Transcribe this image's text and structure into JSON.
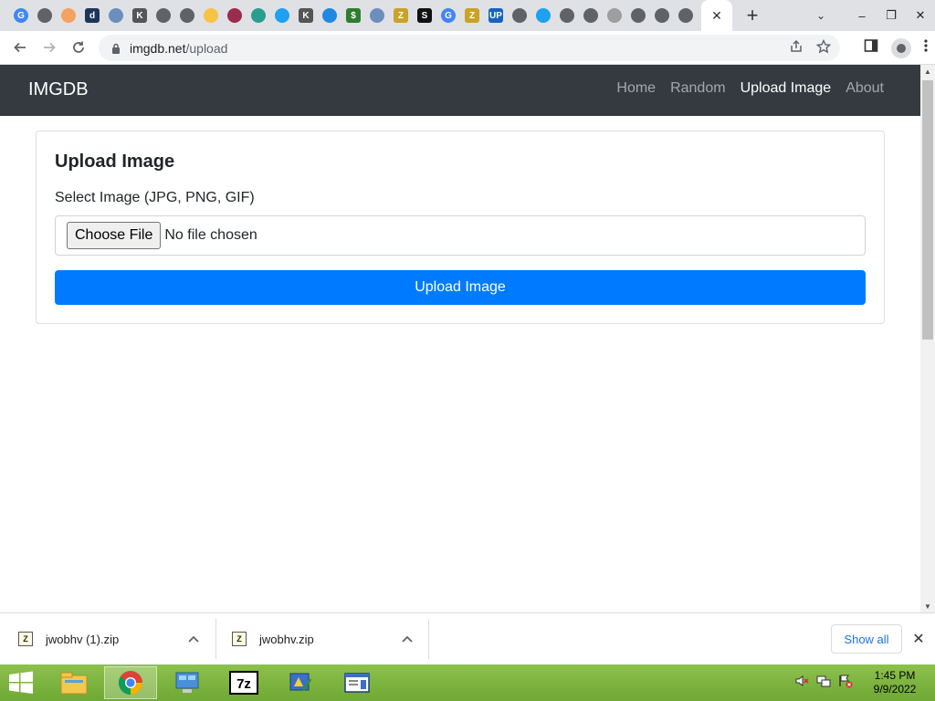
{
  "browser": {
    "url_host": "imgdb.net",
    "url_path": "/upload",
    "tab_favicons": [
      {
        "icon": "google-icon",
        "color": "#4285f4",
        "glyph": "G"
      },
      {
        "icon": "globe-icon",
        "color": "#5f6368",
        "glyph": ""
      },
      {
        "icon": "compass-icon",
        "color": "#f4a261",
        "glyph": ""
      },
      {
        "icon": "d-icon",
        "color": "#1d3557",
        "glyph": "d"
      },
      {
        "icon": "home-icon",
        "color": "#6c8ebf",
        "glyph": ""
      },
      {
        "icon": "kf-icon",
        "color": "#555555",
        "glyph": "K"
      },
      {
        "icon": "globe-icon",
        "color": "#5f6368",
        "glyph": ""
      },
      {
        "icon": "globe-icon",
        "color": "#5f6368",
        "glyph": ""
      },
      {
        "icon": "note-icon",
        "color": "#f6c343",
        "glyph": ""
      },
      {
        "icon": "chevrons-icon",
        "color": "#9b2c4b",
        "glyph": ""
      },
      {
        "icon": "tag-icon",
        "color": "#2a9d8f",
        "glyph": ""
      },
      {
        "icon": "twitter-icon",
        "color": "#1da1f2",
        "glyph": ""
      },
      {
        "icon": "kf-icon",
        "color": "#555555",
        "glyph": "K"
      },
      {
        "icon": "arrow-icon",
        "color": "#1e88e5",
        "glyph": ""
      },
      {
        "icon": "dollar-icon",
        "color": "#2e7d32",
        "glyph": "$"
      },
      {
        "icon": "home-icon",
        "color": "#6c8ebf",
        "glyph": ""
      },
      {
        "icon": "zip-icon",
        "color": "#c9a227",
        "glyph": "Z"
      },
      {
        "icon": "s-icon",
        "color": "#111111",
        "glyph": "S"
      },
      {
        "icon": "google-icon",
        "color": "#4285f4",
        "glyph": "G"
      },
      {
        "icon": "zip-icon",
        "color": "#c9a227",
        "glyph": "Z"
      },
      {
        "icon": "up-icon",
        "color": "#1565c0",
        "glyph": "UP"
      },
      {
        "icon": "globe-icon",
        "color": "#5f6368",
        "glyph": ""
      },
      {
        "icon": "twitter-icon",
        "color": "#1da1f2",
        "glyph": ""
      },
      {
        "icon": "globe-icon",
        "color": "#5f6368",
        "glyph": ""
      },
      {
        "icon": "globe-icon",
        "color": "#5f6368",
        "glyph": ""
      },
      {
        "icon": "globe-icon",
        "color": "#9e9e9e",
        "glyph": ""
      },
      {
        "icon": "globe-icon",
        "color": "#5f6368",
        "glyph": ""
      },
      {
        "icon": "globe-icon",
        "color": "#5f6368",
        "glyph": ""
      },
      {
        "icon": "globe-icon",
        "color": "#5f6368",
        "glyph": ""
      }
    ]
  },
  "site": {
    "brand": "IMGDB",
    "nav": [
      {
        "label": "Home",
        "active": false
      },
      {
        "label": "Random",
        "active": false
      },
      {
        "label": "Upload Image",
        "active": true
      },
      {
        "label": "About",
        "active": false
      }
    ]
  },
  "upload_card": {
    "title": "Upload Image",
    "field_label": "Select Image (JPG, PNG, GIF)",
    "choose_button": "Choose File",
    "file_status": "No file chosen",
    "submit_button": "Upload Image"
  },
  "downloads": {
    "items": [
      {
        "name": "jwobhv (1).zip"
      },
      {
        "name": "jwobhv.zip"
      }
    ],
    "show_all": "Show all"
  },
  "taskbar": {
    "apps": [
      {
        "icon": "file-explorer-icon",
        "active": false
      },
      {
        "icon": "chrome-icon",
        "active": true
      },
      {
        "icon": "control-panel-icon",
        "active": false
      },
      {
        "icon": "7zip-icon",
        "active": false,
        "glyph": "7z"
      },
      {
        "icon": "installer-icon",
        "active": false
      },
      {
        "icon": "notepad-icon",
        "active": false
      }
    ],
    "time": "1:45 PM",
    "date": "9/9/2022"
  },
  "colors": {
    "navbar_bg": "#343a40",
    "primary_button": "#007bff",
    "taskbar_bg": "#7cb342"
  }
}
